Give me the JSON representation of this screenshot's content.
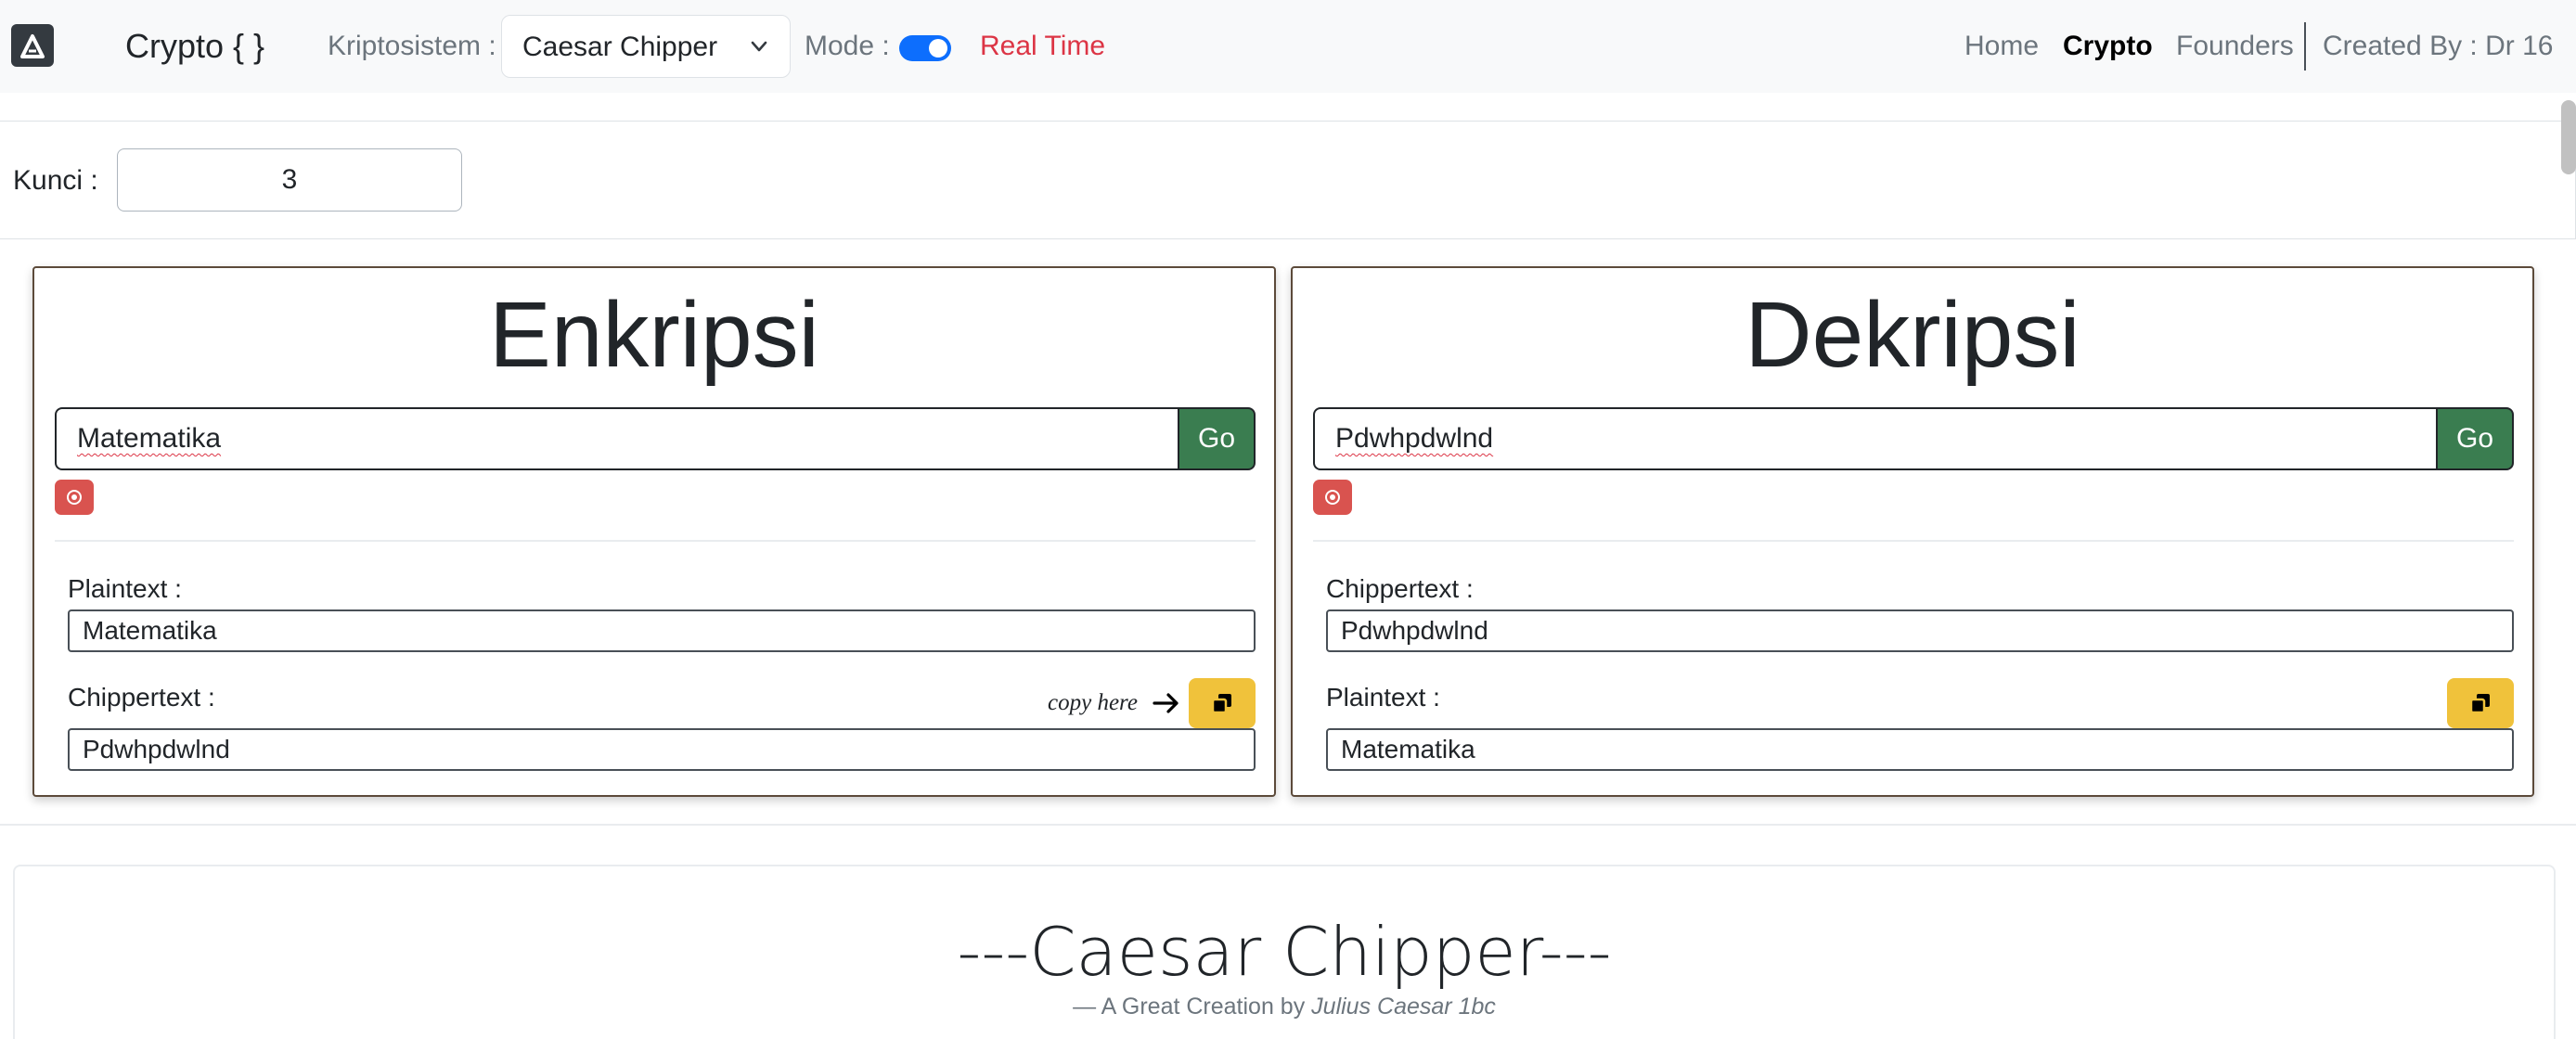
{
  "navbar": {
    "brand": "Crypto { }",
    "kripto_label": "Kriptosistem :",
    "kripto_value": "Caesar Chipper",
    "mode_label": "Mode :",
    "mode_on": true,
    "realtime": "Real Time",
    "links": [
      "Home",
      "Crypto",
      "Founders"
    ],
    "active_link": "Crypto",
    "created_by": "Created By :  Dr 16"
  },
  "key": {
    "label": "Kunci :",
    "value": "3"
  },
  "enkripsi": {
    "title": "Enkripsi",
    "input": "Matematika",
    "go": "Go",
    "field1_label": "Plaintext :",
    "field1_value": "Matematika",
    "field2_label": "Chippertext :",
    "field2_value": "Pdwhpdwlnd",
    "copy_hint": "copy here"
  },
  "dekripsi": {
    "title": "Dekripsi",
    "input": "Pdwhpdwlnd",
    "go": "Go",
    "field1_label": "Chippertext :",
    "field1_value": "Pdwhpdwlnd",
    "field2_label": "Plaintext :",
    "field2_value": "Matematika"
  },
  "footer": {
    "title": "---Caesar Chipper---",
    "sub_prefix": "—  A Great Creation by ",
    "sub_author": "Julius Caesar 1bc"
  },
  "colors": {
    "go": "#3a7d50",
    "clear": "#d9534f",
    "copy": "#f0c23b",
    "toggle": "#0d6efd",
    "realtime": "#dc3545"
  }
}
